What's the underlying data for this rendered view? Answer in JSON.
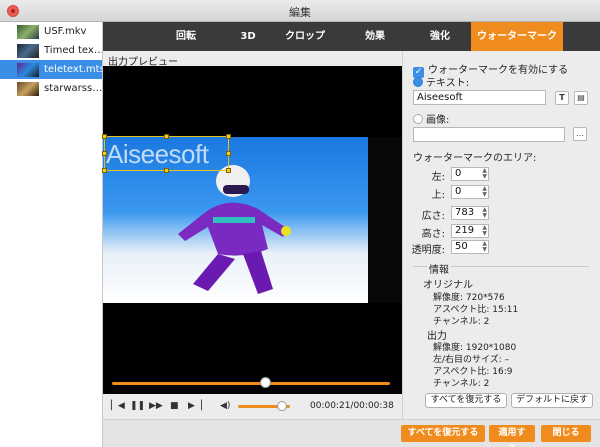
{
  "window": {
    "title": "編集"
  },
  "sidebar": {
    "files": [
      {
        "name": "USF.mkv"
      },
      {
        "name": "Timed tex…"
      },
      {
        "name": "teletext.mts"
      },
      {
        "name": "starwarss…"
      }
    ],
    "selected_index": 2
  },
  "tabs": [
    {
      "label": "回転"
    },
    {
      "label": "3D"
    },
    {
      "label": "クロップ"
    },
    {
      "label": "効果"
    },
    {
      "label": "強化"
    },
    {
      "label": "ウォーターマーク"
    }
  ],
  "active_tab_index": 5,
  "preview": {
    "label": "出力プレビュー",
    "watermark_text": "Aiseesoft",
    "timeline_progress": 0.55,
    "volume_level": 0.85,
    "time_display": "00:00:21/00:00:38"
  },
  "watermark_panel": {
    "enable_label": "ウォーターマークを有効にする",
    "enable_checked": true,
    "text_option_label": "テキスト:",
    "text_option_selected": true,
    "text_value": "Aiseesoft",
    "image_option_label": "画像:",
    "image_option_selected": false,
    "image_value": "",
    "browse_label": "…",
    "area_label": "ウォーターマークのエリア:",
    "fields": [
      {
        "label": "左:",
        "value": "0"
      },
      {
        "label": "上:",
        "value": "0"
      },
      {
        "label": "広さ:",
        "value": "783"
      },
      {
        "label": "高さ:",
        "value": "219"
      },
      {
        "label": "透明度:",
        "value": "50"
      }
    ]
  },
  "info": {
    "heading": "情報",
    "original_heading": "オリジナル",
    "original_lines": [
      "解像度: 720*576",
      "アスペクト比: 15:11",
      "チャンネル: 2"
    ],
    "output_heading": "出力",
    "output_lines": [
      "解像度: 1920*1080",
      "左/右目のサイズ: –",
      "アスペクト比: 16:9",
      "チャンネル: 2"
    ]
  },
  "panel_buttons": {
    "restore_all": "すべてを復元する",
    "reset_default": "デフォルトに戻す"
  },
  "bottom_buttons": {
    "restore_all": "すべてを復元する",
    "apply": "適用する",
    "close": "閉じる"
  },
  "colors": {
    "accent": "#f08c1e",
    "selection": "#3a8ee6",
    "tab_bar": "#3a3a3a"
  }
}
